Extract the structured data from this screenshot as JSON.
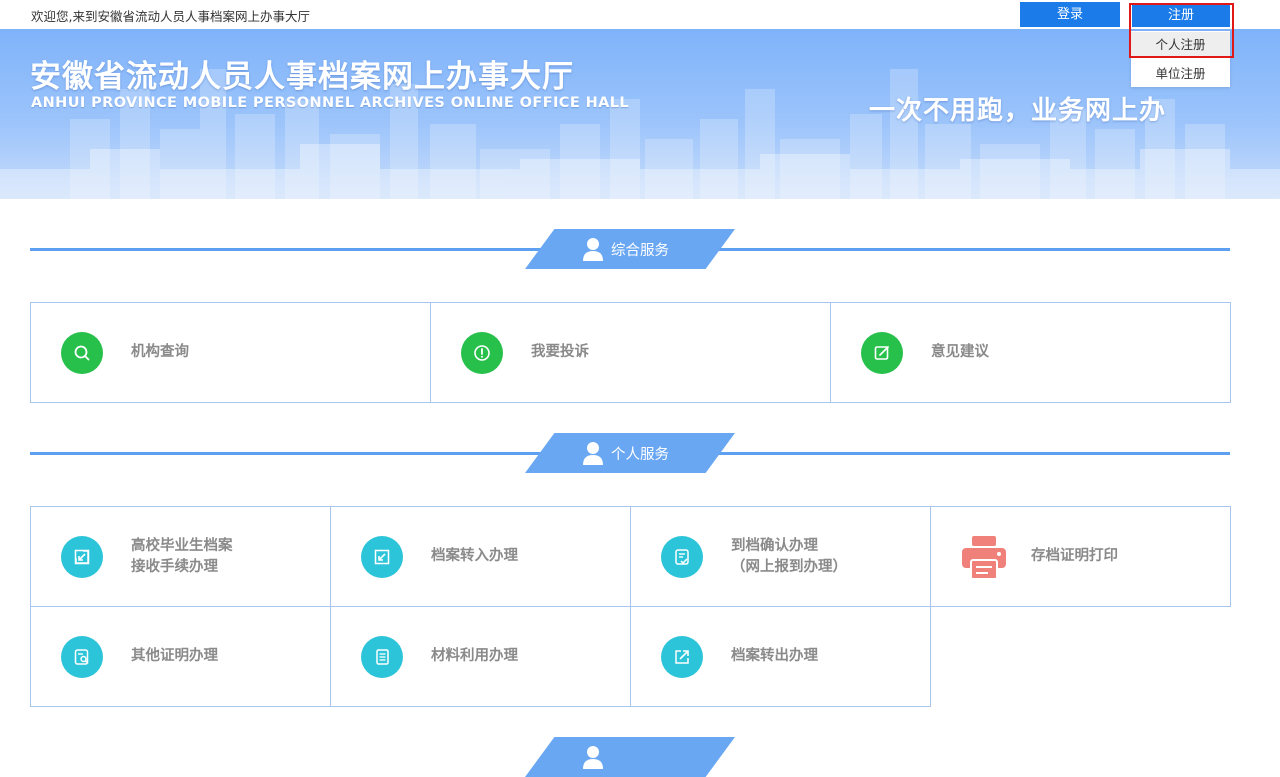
{
  "topbar": {
    "welcome": "欢迎您,来到安徽省流动人员人事档案网上办事大厅",
    "login_label": "登录",
    "register_label": "注册",
    "register_menu": [
      "个人注册",
      "单位注册"
    ]
  },
  "banner": {
    "title": "安徽省流动人员人事档案网上办事大厅",
    "subtitle": "ANHUI PROVINCE MOBILE PERSONNEL ARCHIVES ONLINE OFFICE HALL",
    "slogan": "一次不用跑，业务网上办"
  },
  "sections": {
    "general": {
      "title": "综合服务",
      "items": [
        {
          "line1": "机构查询",
          "line2": "",
          "icon": "search-icon"
        },
        {
          "line1": "我要投诉",
          "line2": "",
          "icon": "alert-icon"
        },
        {
          "line1": "意见建议",
          "line2": "",
          "icon": "edit-icon"
        }
      ]
    },
    "personal": {
      "title": "个人服务",
      "items": [
        {
          "line1": "高校毕业生档案",
          "line2": "接收手续办理",
          "icon": "arrow-in-icon"
        },
        {
          "line1": "档案转入办理",
          "line2": "",
          "icon": "arrow-in-icon"
        },
        {
          "line1": "到档确认办理",
          "line2": "（网上报到办理）",
          "icon": "document-check-icon"
        },
        {
          "line1": "存档证明打印",
          "line2": "",
          "icon": "printer-icon"
        },
        {
          "line1": "其他证明办理",
          "line2": "",
          "icon": "certificate-search-icon"
        },
        {
          "line1": "材料利用办理",
          "line2": "",
          "icon": "document-list-icon"
        },
        {
          "line1": "档案转出办理",
          "line2": "",
          "icon": "arrow-out-icon"
        }
      ]
    }
  },
  "colors": {
    "primary": "#1a7be9",
    "section_blue": "#6aa7f3",
    "green_icon": "#27c04b",
    "teal_icon": "#2cc4d8",
    "printer_icon": "#f0807a",
    "highlight": "#e01818"
  }
}
